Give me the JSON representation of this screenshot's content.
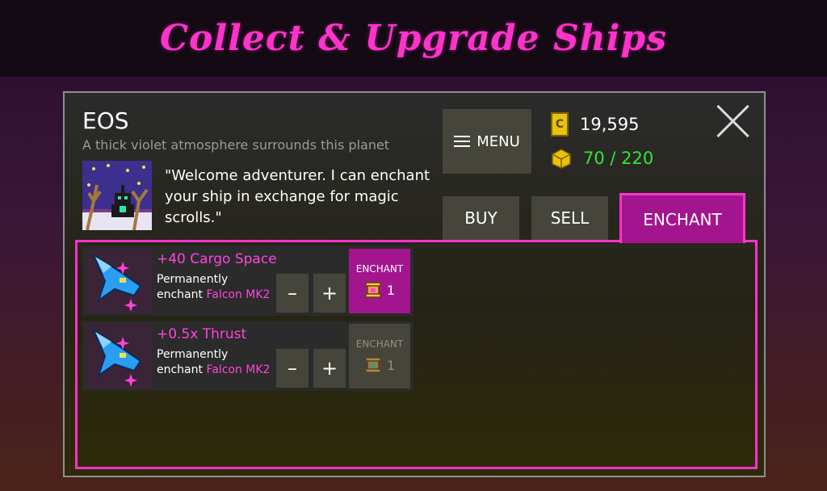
{
  "banner": {
    "title": "Collect & Upgrade Ships"
  },
  "planet": {
    "name": "EOS",
    "description": "A thick violet atmosphere surrounds this planet",
    "greeting": "\"Welcome adventurer. I can enchant your ship in exchange for magic scrolls.\""
  },
  "menu": {
    "label": "MENU",
    "icon": "hamburger-icon"
  },
  "resources": {
    "credits": {
      "value": "19,595",
      "icon": "credits-icon",
      "color": "#ffffff"
    },
    "cargo": {
      "value": "70 / 220",
      "icon": "cargo-crate-icon",
      "color": "#33e633"
    }
  },
  "tabs": [
    {
      "label": "BUY",
      "active": false
    },
    {
      "label": "SELL",
      "active": false
    },
    {
      "label": "ENCHANT",
      "active": true
    }
  ],
  "enchantments": [
    {
      "bonus": "+40 Cargo Space",
      "line1": "Permanently",
      "line2_prefix": "enchant",
      "ship": "Falcon MK2",
      "minus": "–",
      "plus": "+",
      "button": "ENCHANT",
      "cost": "1",
      "enabled": true
    },
    {
      "bonus": "+0.5x Thrust",
      "line1": "Permanently",
      "line2_prefix": "enchant",
      "ship": "Falcon MK2",
      "minus": "–",
      "plus": "+",
      "button": "ENCHANT",
      "cost": "1",
      "enabled": false
    }
  ],
  "colors": {
    "accent": "#ff33cc",
    "active_tab": "#a3158f",
    "button": "#45453b",
    "cargo_text": "#33e633"
  }
}
